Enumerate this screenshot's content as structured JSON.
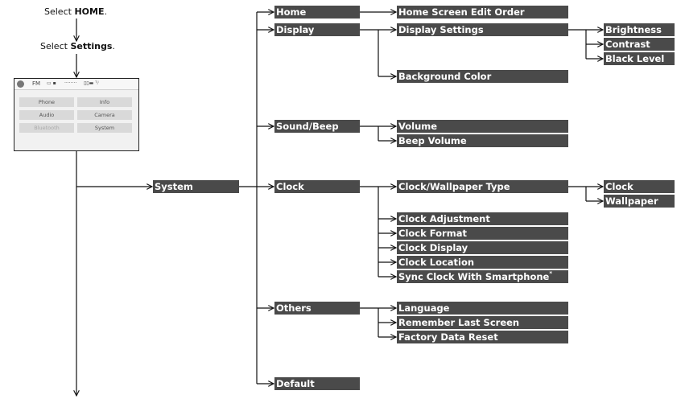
{
  "instructions": {
    "step1_prefix": "Select ",
    "step1_target": "HOME",
    "step1_suffix": ".",
    "step2_prefix": "Select ",
    "step2_target": "Settings",
    "step2_suffix": "."
  },
  "home_screen": {
    "status_bar": {
      "source": "FM",
      "indicator1": "▭ ▪",
      "indicator2": "········",
      "indicator3": "▯▯▬ ᵀᵢˡ"
    },
    "buttons": [
      {
        "label": "Phone",
        "enabled": true
      },
      {
        "label": "Info",
        "enabled": true
      },
      {
        "label": "Audio",
        "enabled": true
      },
      {
        "label": "Camera",
        "enabled": true
      },
      {
        "label": "Bluetooth",
        "enabled": false
      },
      {
        "label": "System",
        "enabled": true
      }
    ]
  },
  "tree": {
    "root": "System",
    "level1": {
      "home": "Home",
      "display": "Display",
      "sound_beep": "Sound/Beep",
      "clock": "Clock",
      "others": "Others",
      "default": "Default"
    },
    "home_children": [
      "Home Screen Edit Order"
    ],
    "display_children": [
      "Display Settings",
      "Background Color"
    ],
    "display_settings_children": [
      "Brightness",
      "Contrast",
      "Black Level"
    ],
    "sound_beep_children": [
      "Volume",
      "Beep Volume"
    ],
    "clock_children": [
      "Clock/Wallpaper Type",
      "Clock Adjustment",
      "Clock Format",
      "Clock Display",
      "Clock Location",
      "Sync Clock With Smartphone"
    ],
    "clock_footnote_marker": "*",
    "clock_wallpaper_children": [
      "Clock",
      "Wallpaper"
    ],
    "others_children": [
      "Language",
      "Remember Last Screen",
      "Factory Data Reset"
    ]
  },
  "colors": {
    "box_fill": "#4a4a4a",
    "box_text": "#ffffff",
    "line": "#111111"
  }
}
